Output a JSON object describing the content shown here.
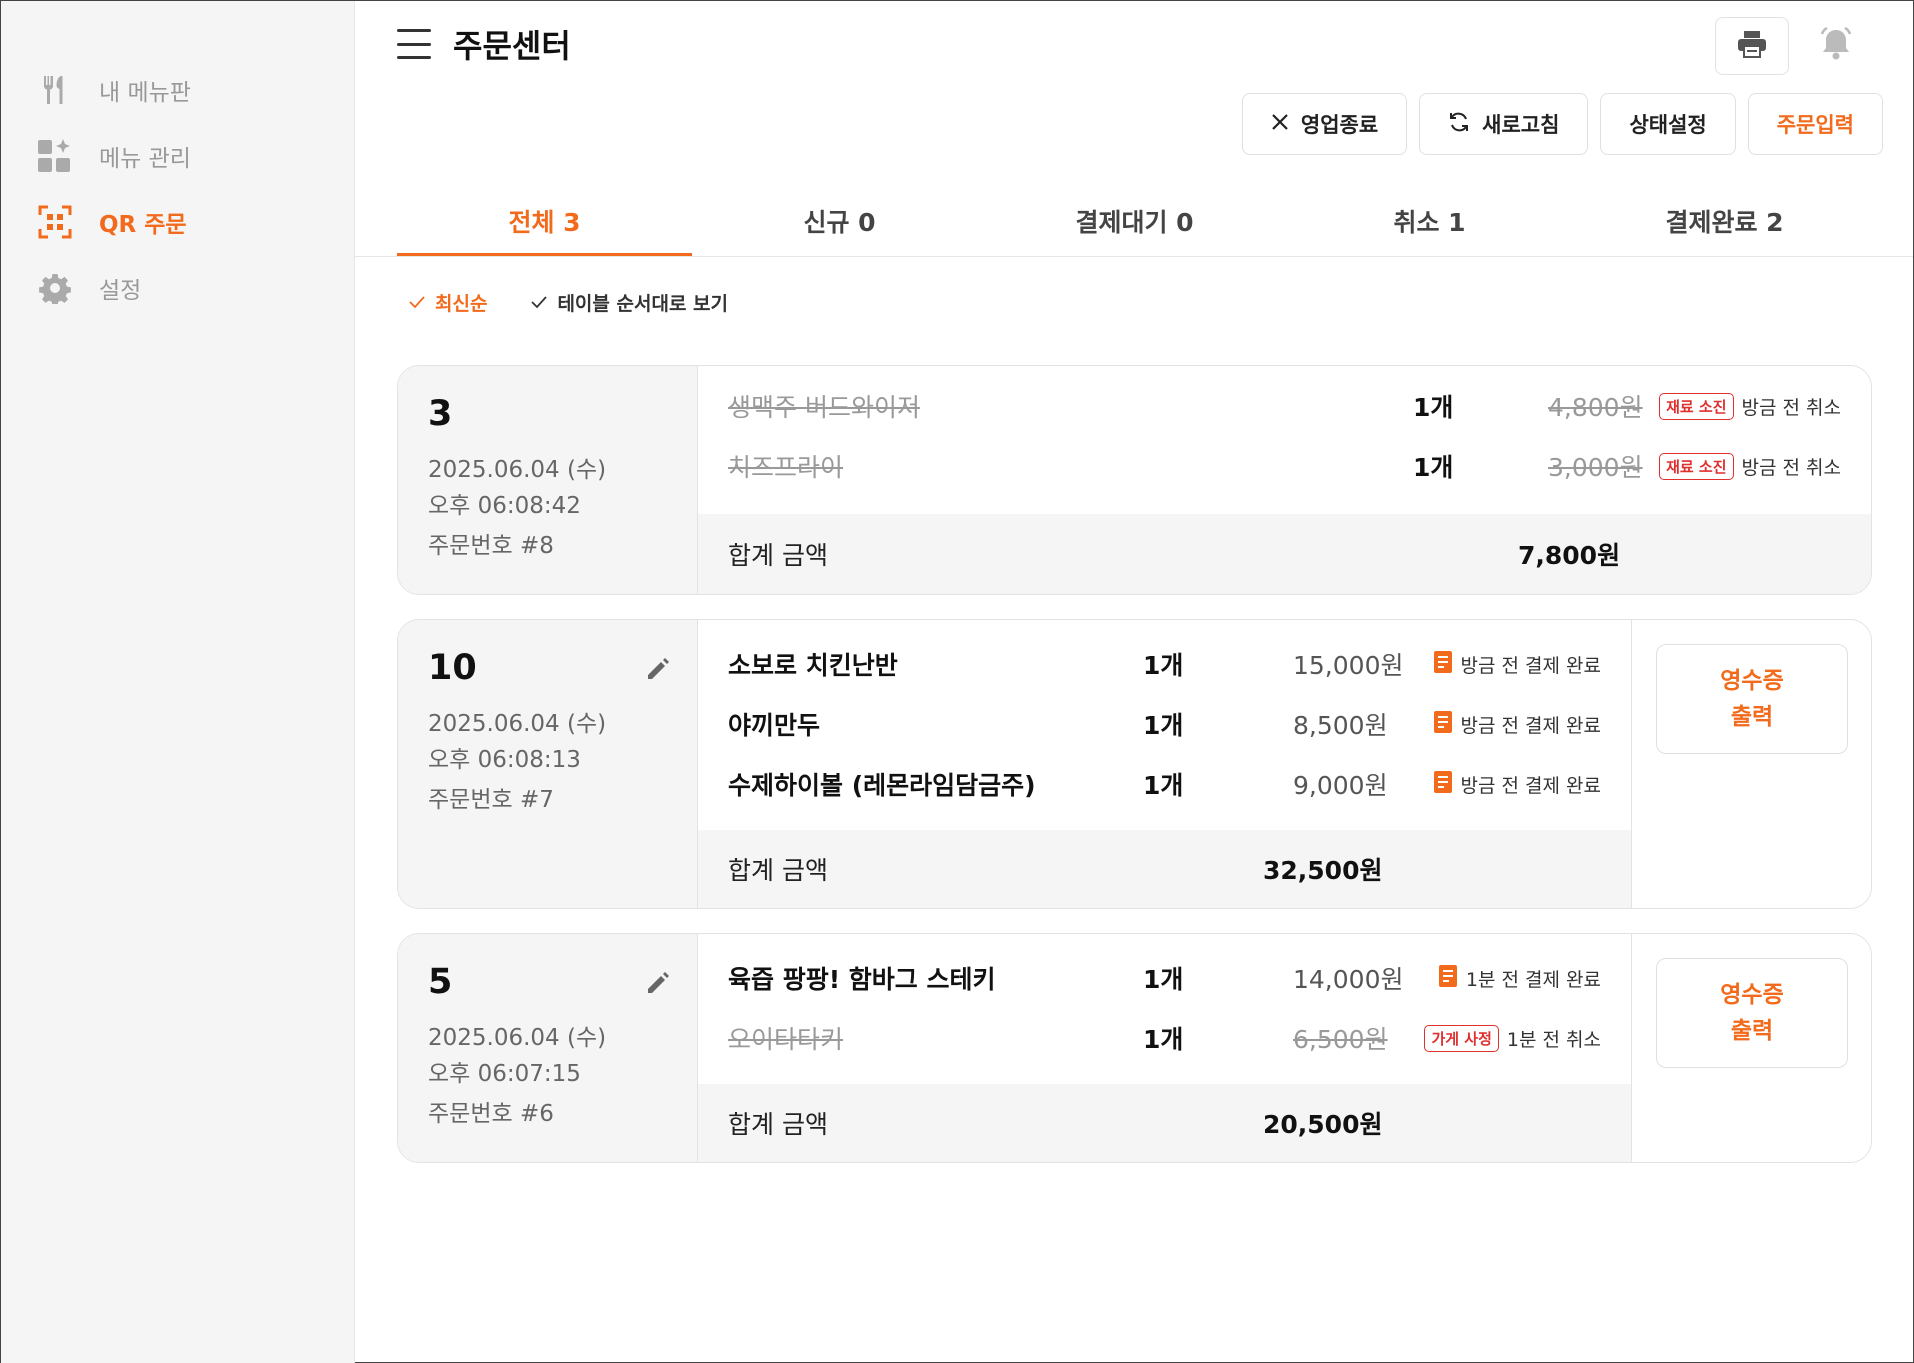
{
  "sidebar": {
    "items": [
      {
        "label": "내 메뉴판",
        "icon": "utensils-icon"
      },
      {
        "label": "메뉴 관리",
        "icon": "grid-sparkle-icon"
      },
      {
        "label": "QR 주문",
        "icon": "qr-icon"
      },
      {
        "label": "설정",
        "icon": "gear-icon"
      }
    ]
  },
  "header": {
    "title": "주문센터"
  },
  "actions": {
    "close_shop": "영업종료",
    "refresh": "새로고침",
    "status_setting": "상태설정",
    "order_input": "주문입력"
  },
  "tabs": [
    {
      "label": "전체 3"
    },
    {
      "label": "신규 0"
    },
    {
      "label": "결제대기 0"
    },
    {
      "label": "취소 1"
    },
    {
      "label": "결제완료 2"
    }
  ],
  "sorts": {
    "latest": "최신순",
    "by_table": "테이블 순서대로 보기"
  },
  "orders": [
    {
      "table": "3",
      "date": "2025.06.04 (수)",
      "time": "오후 06:08:42",
      "order_no": "주문번호 #8",
      "items": [
        {
          "name": "생맥주 버드와이저",
          "qty": "1개",
          "price": "4,800원",
          "badge": "재료 소진",
          "status": "방금 전 취소"
        },
        {
          "name": "치즈프라이",
          "qty": "1개",
          "price": "3,000원",
          "badge": "재료 소진",
          "status": "방금 전 취소"
        }
      ],
      "total_label": "합계 금액",
      "total": "7,800원"
    },
    {
      "table": "10",
      "date": "2025.06.04 (수)",
      "time": "오후 06:08:13",
      "order_no": "주문번호 #7",
      "items": [
        {
          "name": "소보로 치킨난반",
          "qty": "1개",
          "price": "15,000원",
          "status": "방금 전 결제 완료"
        },
        {
          "name": "야끼만두",
          "qty": "1개",
          "price": "8,500원",
          "status": "방금 전 결제 완료"
        },
        {
          "name": "수제하이볼 (레몬라임담금주)",
          "qty": "1개",
          "price": "9,000원",
          "status": "방금 전 결제 완료"
        }
      ],
      "total_label": "합계 금액",
      "total": "32,500원",
      "receipt_line1": "영수증",
      "receipt_line2": "출력"
    },
    {
      "table": "5",
      "date": "2025.06.04 (수)",
      "time": "오후 06:07:15",
      "order_no": "주문번호 #6",
      "items": [
        {
          "name": "육즙 팡팡! 함바그 스테키",
          "qty": "1개",
          "price": "14,000원",
          "status": "1분 전 결제 완료"
        },
        {
          "name": "오이타타키",
          "qty": "1개",
          "price": "6,500원",
          "badge": "가게 사정",
          "status": "1분 전 취소"
        }
      ],
      "total_label": "합계 금액",
      "total": "20,500원",
      "receipt_line1": "영수증",
      "receipt_line2": "출력"
    }
  ],
  "colors": {
    "accent": "#f26a1b",
    "badge": "#e03030"
  }
}
